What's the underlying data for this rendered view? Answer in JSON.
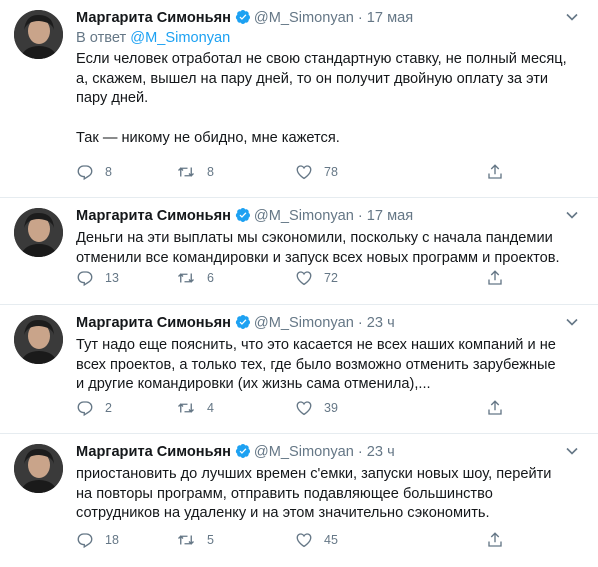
{
  "colors": {
    "accent": "#1da1f2",
    "muted": "#657786",
    "text": "#14171a",
    "divider": "#e6ecf0"
  },
  "tweets": [
    {
      "name": "Маргарита Симоньян",
      "handle": "@M_Simonyan",
      "dot": "·",
      "time": "17 мая",
      "reply_prefix": "В ответ",
      "reply_handle": "@M_Simonyan",
      "text": "Если человек отработал не свою стандартную ставку, не полный месяц,\nа, скажем, вышел на пару дней, то он получит двойную оплату за эти\nпару дней.\n\nТак — никому не обидно, мне кажется.",
      "replies": "8",
      "retweets": "8",
      "likes": "78"
    },
    {
      "name": "Маргарита Симоньян",
      "handle": "@M_Simonyan",
      "dot": "·",
      "time": "17 мая",
      "text": "Деньги на эти выплаты мы сэкономили, поскольку с начала пандемии\nотменили все командировки и запуск всех новых программ и проектов.",
      "replies": "13",
      "retweets": "6",
      "likes": "72"
    },
    {
      "name": "Маргарита Симоньян",
      "handle": "@M_Simonyan",
      "dot": "·",
      "time": "23 ч",
      "text": "Тут надо еще пояснить, что это касается не всех наших компаний и не\nвсех проектов, а только тех, где было возможно отменить зарубежные\nи другие командировки (их жизнь сама отменила),...",
      "replies": "2",
      "retweets": "4",
      "likes": "39"
    },
    {
      "name": "Маргарита Симоньян",
      "handle": "@M_Simonyan",
      "dot": "·",
      "time": "23 ч",
      "text": "приостановить до лучших времен с'емки, запуски новых шоу, перейти\nна повторы программ, отправить подавляющее большинство\nсотрудников на удаленку и на этом значительно сэкономить.",
      "replies": "18",
      "retweets": "5",
      "likes": "45"
    }
  ]
}
